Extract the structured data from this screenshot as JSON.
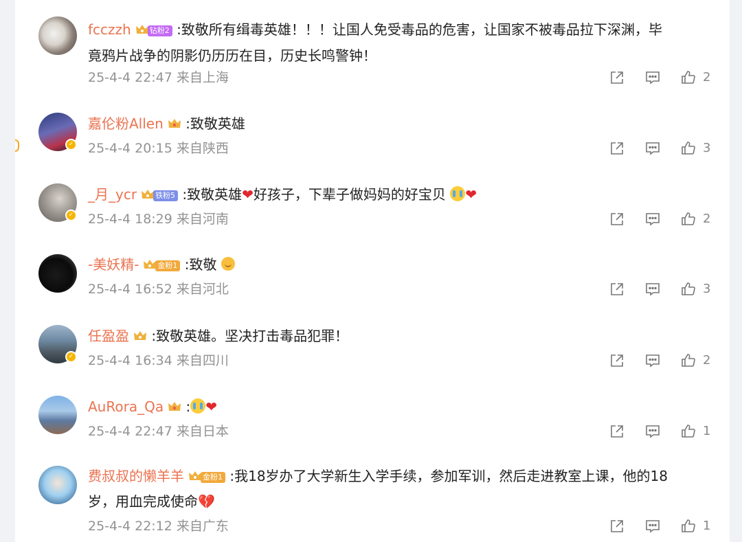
{
  "colors": {
    "username": "#eb7350",
    "meta": "#939393",
    "icon": "#777777"
  },
  "icons": {
    "share": "share-icon",
    "comment": "comment-icon",
    "like": "thumbs-up-icon",
    "crown": "crown-icon",
    "heart": "heart-emoji",
    "broken_heart": "broken-heart-emoji",
    "cry": "crying-emoji",
    "smile": "smile-emoji"
  },
  "comments": [
    {
      "username": "fcczzh",
      "badge": "钻粉2",
      "text_a": ":致敬所有缉毒英雄！！！让国人免受毒品的危害，让国家不被毒品拉下深渊，毕",
      "text_b": "竟鸦片战争的阴影仍历历在目，历史长鸣警钟！",
      "time": "25-4-4 22:47",
      "location": "来自上海",
      "likes": "2"
    },
    {
      "username": "嘉伦粉Allen",
      "text": ":致敬英雄",
      "time": "25-4-4 20:15",
      "location": "来自陕西",
      "likes": "3"
    },
    {
      "username": "_月_ycr",
      "badge": "铁粉5",
      "text_a": ":致敬英雄",
      "text_b": "好孩子，下辈子做妈妈的好宝贝",
      "time": "25-4-4 18:29",
      "location": "来自河南",
      "likes": "2"
    },
    {
      "username": "-美妖精-",
      "badge": "金粉1",
      "text": ":致敬",
      "time": "25-4-4 16:52",
      "location": "来自河北",
      "likes": "3"
    },
    {
      "username": "任盈盈",
      "text": ":致敬英雄。坚决打击毒品犯罪！",
      "time": "25-4-4 16:34",
      "location": "来自四川",
      "likes": "2"
    },
    {
      "username": "AuRora_Qa",
      "text": ":",
      "time": "25-4-4 22:47",
      "location": "来自日本",
      "likes": "1"
    },
    {
      "username": "费叔叔的懒羊羊",
      "badge": "金粉1",
      "text_a": ":我18岁办了大学新生入学手续，参加军训，然后走进教室上课，他的18",
      "text_b": "岁，用血完成使命",
      "time": "25-4-4 22:12",
      "location": "来自广东",
      "likes": "1"
    }
  ]
}
